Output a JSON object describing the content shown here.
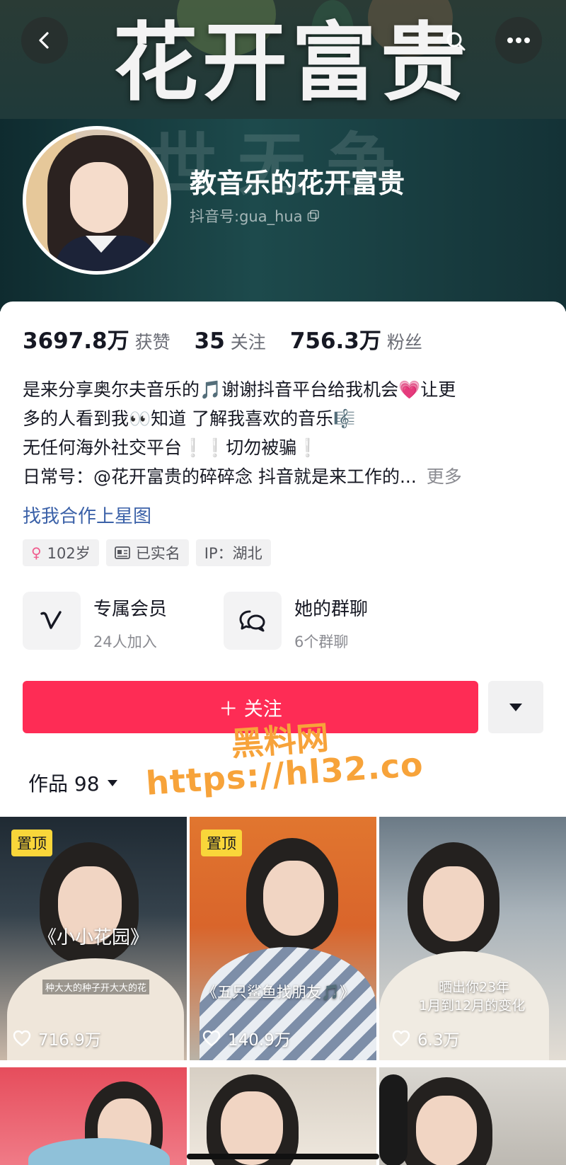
{
  "cover": {
    "title": "花开富贵",
    "bg_text": "世无争"
  },
  "profile": {
    "nickname": "教音乐的花开富贵",
    "douyin_id": "抖音号:gua_hua"
  },
  "stats": [
    {
      "value": "3697.8万",
      "label": "获赞"
    },
    {
      "value": "35",
      "label": "关注"
    },
    {
      "value": "756.3万",
      "label": "粉丝"
    }
  ],
  "bio": {
    "lines": [
      "是来分享奥尔夫音乐的🎵谢谢抖音平台给我机会💗让更",
      "多的人看到我👀知道 了解我喜欢的音乐🎼",
      "无任何海外社交平台❕❕切勿被骗❕",
      "日常号：@花开富贵的碎碎念 抖音就是来工作的..."
    ],
    "more": "更多",
    "xingtu_link": "找我合作上星图"
  },
  "tags": [
    {
      "text": "102岁",
      "icon": "female-icon"
    },
    {
      "text": "已实名",
      "icon": "id-card-icon"
    },
    {
      "text": "IP：湖北",
      "icon": ""
    }
  ],
  "features": {
    "vip": {
      "title": "专属会员",
      "subtitle": "24人加入",
      "icon": "v-icon"
    },
    "group": {
      "title": "她的群聊",
      "subtitle": "6个群聊",
      "icon": "chat-bubbles-icon"
    }
  },
  "actions": {
    "follow": "＋ 关注"
  },
  "works_tab": {
    "label": "作品 98"
  },
  "watermark": {
    "line1": "黑料网",
    "line2": "https://hl32.co"
  },
  "videos": [
    {
      "pinned": "置顶",
      "caption": "《小小花园》",
      "subcaption": "种大大的种子开大大的花",
      "likes": "716.9万"
    },
    {
      "pinned": "置顶",
      "caption": "《五只鲨鱼找朋友🎵》",
      "subcaption": "",
      "likes": "140.9万"
    },
    {
      "pinned": "",
      "caption": "晒出你23年",
      "caption2": "1月到12月的变化",
      "likes": "6.3万"
    },
    {
      "pinned": "",
      "caption": "",
      "likes": ""
    },
    {
      "pinned": "",
      "caption": "",
      "likes": ""
    },
    {
      "pinned": "",
      "caption": "",
      "likes": ""
    }
  ],
  "colors": {
    "accent": "#fe2c55",
    "link": "#3b61a8",
    "pin_badge": "#f9d63a",
    "watermark": "#f7a33a"
  }
}
